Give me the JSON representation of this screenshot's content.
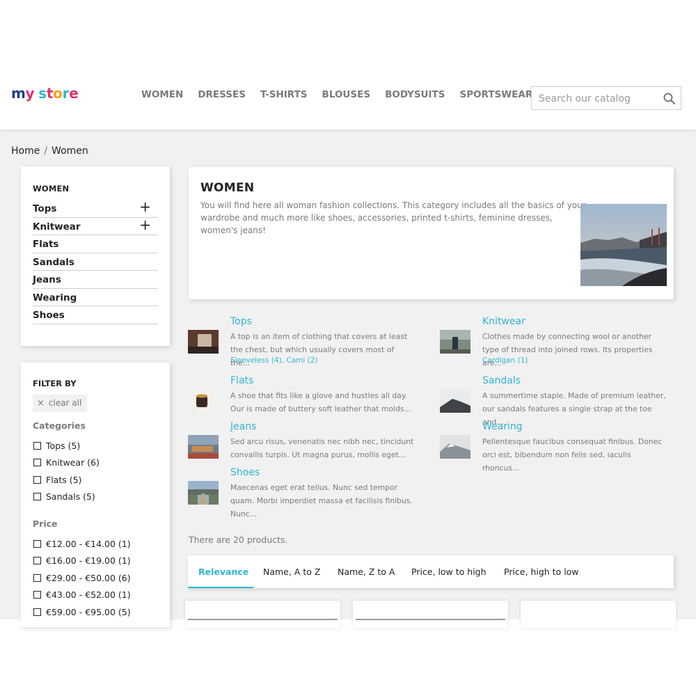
{
  "logo": {
    "text": "my store"
  },
  "nav": [
    "WOMEN",
    "DRESSES",
    "T-SHIRTS",
    "BLOUSES",
    "BODYSUITS",
    "SPORTSWEAR"
  ],
  "search": {
    "placeholder": "Search our catalog",
    "icon": "search-icon"
  },
  "breadcrumb": [
    "Home",
    "Women"
  ],
  "sidebar": {
    "title": "WOMEN",
    "items": [
      {
        "label": "Tops",
        "expandable": true
      },
      {
        "label": "Knitwear",
        "expandable": true
      },
      {
        "label": "Flats",
        "expandable": false
      },
      {
        "label": "Sandals",
        "expandable": false
      },
      {
        "label": "Jeans",
        "expandable": false
      },
      {
        "label": "Wearing",
        "expandable": false
      },
      {
        "label": "Shoes",
        "expandable": false
      }
    ],
    "plus_symbol": "+"
  },
  "filters": {
    "title": "FILTER BY",
    "clear_all": "clear all",
    "clear_icon": "×",
    "categories_title": "Categories",
    "categories": [
      "Tops (5)",
      "Knitwear (6)",
      "Flats (5)",
      "Sandals (5)"
    ],
    "price_title": "Price",
    "prices": [
      "€12.00 - €14.00 (1)",
      "€16.00 - €19.00 (1)",
      "€29.00 - €50.00 (6)",
      "€43.00 - €52.00 (1)",
      "€59.00 - €95.00 (5)"
    ]
  },
  "category": {
    "title": "WOMEN",
    "description": "You will find here all woman fashion collections. This category includes all the basics of your wardrobe and much more like shoes, accessories, printed t-shirts, feminine dresses, women's jeans!"
  },
  "subcategories": [
    {
      "name": "Tops",
      "desc": "A top is an item of clothing that covers at least the chest, but which usually covers most of the...",
      "links": "Sleeveless (4), Cami (2)"
    },
    {
      "name": "Knitwear",
      "desc": "Clothes made by connecting wool or another type of thread into joined rows. Its properties are...",
      "links": "Cardigan (1)"
    },
    {
      "name": "Flats",
      "desc": "A shoe that fits like a glove and hustles all day. Our is made of buttery soft leather that molds...",
      "links": ""
    },
    {
      "name": "Sandals",
      "desc": "A summertime staple. Made of premium leather, our sandals features a single strap at the toe and...",
      "links": ""
    },
    {
      "name": "Jeans",
      "desc": "Sed arcu risus, venenatis nec nibh nec, tincidunt convallis turpis. Ut magna purus, mollis eget...",
      "links": ""
    },
    {
      "name": "Wearing",
      "desc": "Pellentesque faucibus consequat finibus. Donec orci est, bibendum non felis sed, iaculis rhoncus...",
      "links": ""
    },
    {
      "name": "Shoes",
      "desc": "Maecenas eget erat tellus. Nunc sed tempor quam. Morbi imperdiet massa et facilisis finibus. Nunc...",
      "links": ""
    }
  ],
  "product_count": "There are 20 products.",
  "sort_tabs": [
    "Relevance",
    "Name, A to Z",
    "Name, Z to A",
    "Price, low to high",
    "Price, high to low"
  ],
  "colors": {
    "accent": "#2fb5d2",
    "text": "#232323",
    "muted": "#7a7a7a",
    "background": "#f1f1f1"
  }
}
